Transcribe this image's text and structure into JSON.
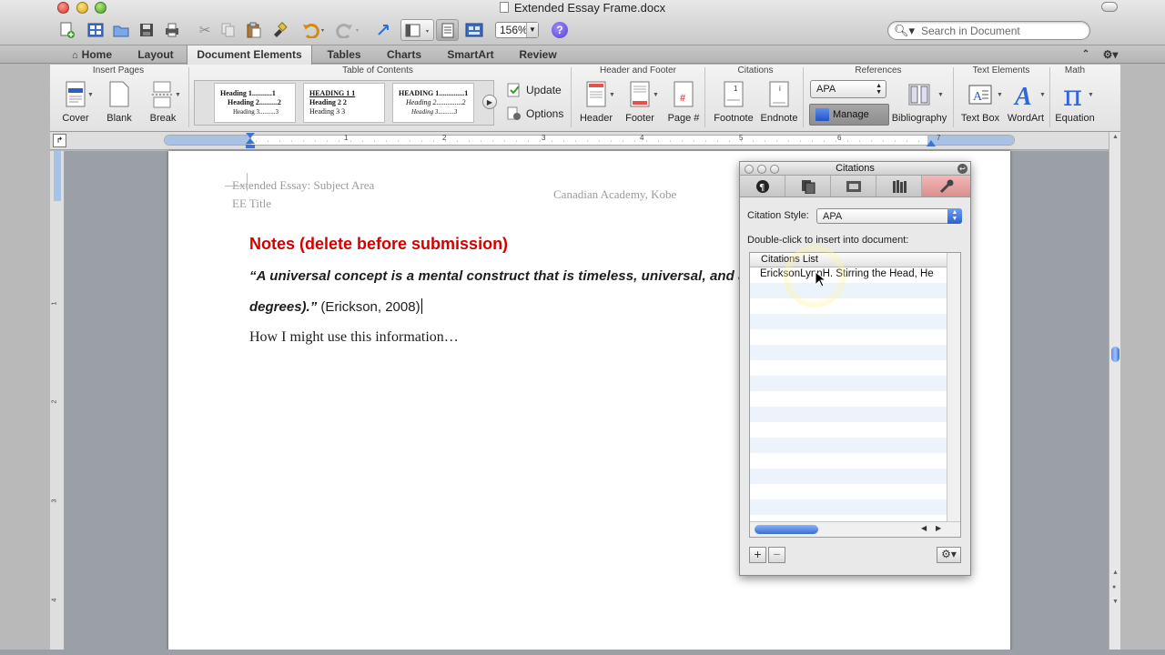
{
  "window": {
    "title": "Extended Essay Frame.docx",
    "zoom": "156%",
    "search_placeholder": "Search in Document"
  },
  "tabs": [
    {
      "label": "Home"
    },
    {
      "label": "Layout"
    },
    {
      "label": "Document Elements",
      "active": true
    },
    {
      "label": "Tables"
    },
    {
      "label": "Charts"
    },
    {
      "label": "SmartArt"
    },
    {
      "label": "Review"
    }
  ],
  "ribbon": {
    "groups": {
      "insert_pages": "Insert Pages",
      "toc": "Table of Contents",
      "header_footer": "Header and Footer",
      "citations": "Citations",
      "references": "References",
      "text_elements": "Text Elements",
      "math": "Math"
    },
    "buttons": {
      "cover": "Cover",
      "blank": "Blank",
      "break": "Break",
      "update": "Update",
      "options": "Options",
      "header": "Header",
      "footer": "Footer",
      "page_num": "Page #",
      "footnote": "Footnote",
      "endnote": "Endnote",
      "style": "APA",
      "manage": "Manage",
      "bibliography": "Bibliography",
      "text_box": "Text Box",
      "wordart": "WordArt",
      "equation": "Equation"
    },
    "toc_thumbs": [
      {
        "h1": "Heading 1...........1",
        "h2": "Heading 2..........2",
        "h3": "Heading 3..........3"
      },
      {
        "h1": "HEADING 1          1",
        "h2": "Heading 2            2",
        "h3": "Heading 3            3"
      },
      {
        "h1": "HEADING 1..............1",
        "h2": "Heading 2..............2",
        "h3": "Heading 3..........3"
      }
    ]
  },
  "ruler": {
    "numbers": [
      "1",
      "2",
      "3",
      "4",
      "5",
      "6",
      "7"
    ],
    "vnumbers": [
      "1",
      "2",
      "3",
      "4"
    ]
  },
  "document": {
    "header_left_1": "Extended Essay: Subject Area",
    "header_left_2": "EE Title",
    "header_right": "Canadian Academy, Kobe",
    "notes_title": "Notes (delete before submission)",
    "quote_line1": "“A universal concept is a mental construct that is timeless, universal, and a",
    "quote_line2_italic": "degrees).”",
    "quote_line2_citation": " (Erickson, 2008)",
    "use_line": "How I might use this information…"
  },
  "citations_palette": {
    "title": "Citations",
    "style_label": "Citation Style:",
    "style_value": "APA",
    "instructions": "Double-click to insert into document:",
    "list_header": "Citations List",
    "items": [
      "EricksonLynnH. Stirring the Head, He"
    ]
  },
  "colors": {
    "notes_red": "#d40000",
    "accent_blue": "#2c5fd0",
    "selected_tab_pink": "#e4a0a0"
  }
}
